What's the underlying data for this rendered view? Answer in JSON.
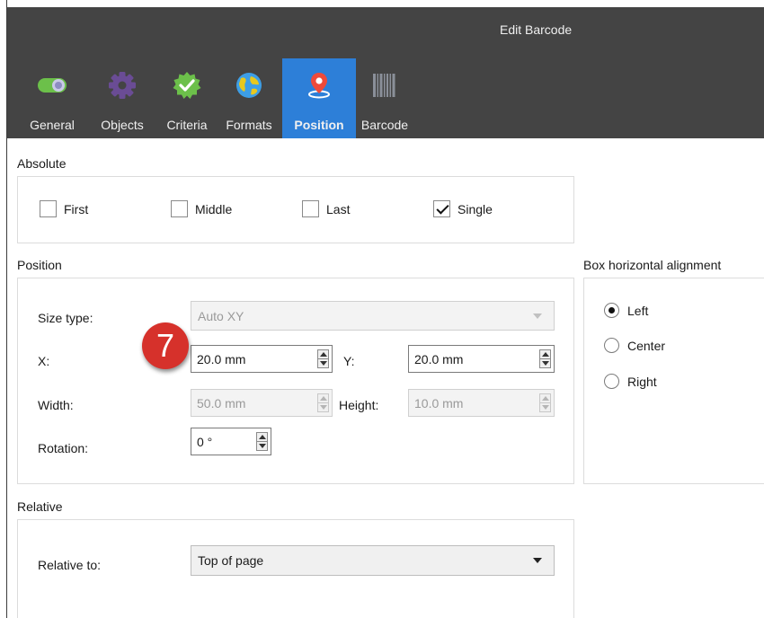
{
  "window": {
    "title": "Edit Barcode"
  },
  "tabs": [
    {
      "label": "General",
      "icon": "toggle-switch-icon"
    },
    {
      "label": "Objects",
      "icon": "gear-icon"
    },
    {
      "label": "Criteria",
      "icon": "check-badge-icon"
    },
    {
      "label": "Formats",
      "icon": "globe-icon"
    },
    {
      "label": "Position",
      "icon": "location-pin-icon",
      "active": true
    },
    {
      "label": "Barcode",
      "icon": "barcode-icon"
    }
  ],
  "absolute": {
    "title": "Absolute",
    "options": [
      {
        "label": "First",
        "checked": false
      },
      {
        "label": "Middle",
        "checked": false
      },
      {
        "label": "Last",
        "checked": false
      },
      {
        "label": "Single",
        "checked": true
      }
    ]
  },
  "position": {
    "title": "Position",
    "size_type_label": "Size type:",
    "size_type_value": "Auto XY",
    "x_label": "X:",
    "x_value": "20.0 mm",
    "y_label": "Y:",
    "y_value": "20.0 mm",
    "width_label": "Width:",
    "width_value": "50.0 mm",
    "height_label": "Height:",
    "height_value": "10.0 mm",
    "rotation_label": "Rotation:",
    "rotation_value": "0 °"
  },
  "box_alignment": {
    "title": "Box horizontal alignment",
    "options": [
      {
        "label": "Left",
        "selected": true
      },
      {
        "label": "Center",
        "selected": false
      },
      {
        "label": "Right",
        "selected": false
      }
    ]
  },
  "relative": {
    "title": "Relative",
    "relative_to_label": "Relative to:",
    "relative_to_value": "Top of page"
  },
  "callout": {
    "number": "7"
  },
  "colors": {
    "header_bg": "#444444",
    "active_tab": "#2d7fd8",
    "callout": "#d6312b"
  }
}
